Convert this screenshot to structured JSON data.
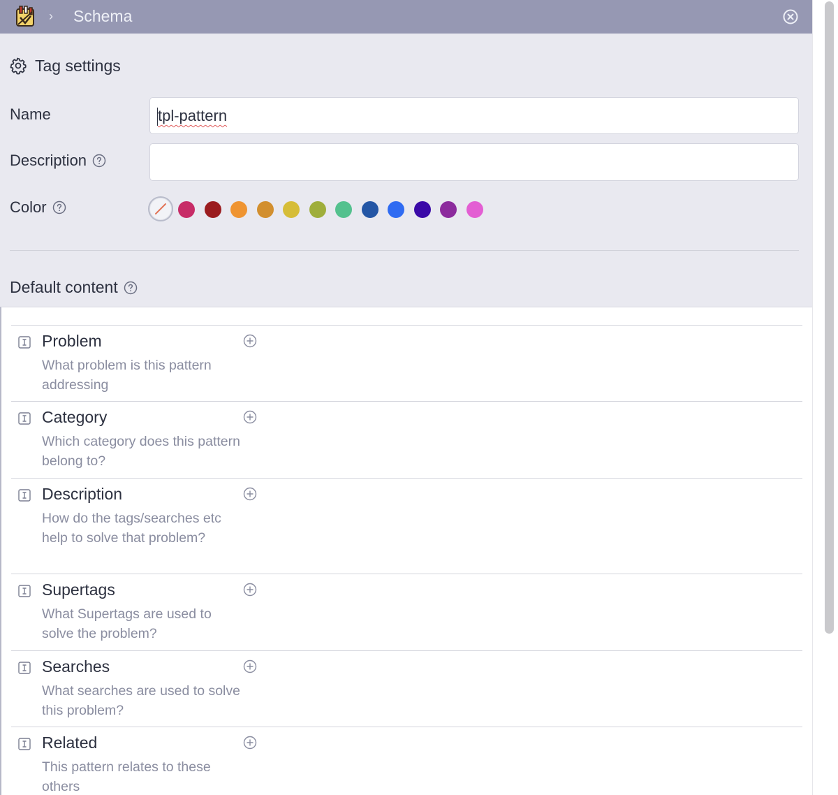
{
  "titlebar": {
    "breadcrumb_separator": "›",
    "title": "Schema"
  },
  "panel": {
    "heading": "Tag settings",
    "name_label": "Name",
    "name_value": "tpl-pattern",
    "description_label": "Description",
    "description_value": "",
    "color_label": "Color",
    "colors": [
      "#c72c67",
      "#9b1c1f",
      "#ef9431",
      "#d28f2f",
      "#d6bd38",
      "#9fae3b",
      "#54c18e",
      "#2456a5",
      "#2f6bf2",
      "#3b0aa8",
      "#8c2b9d",
      "#e35ed3"
    ],
    "selected_color": "none",
    "default_content_label": "Default content"
  },
  "fields": [
    {
      "title": "Problem",
      "description": "What problem is this pattern addressing"
    },
    {
      "title": "Category",
      "description": "Which category does this pattern belong to?"
    },
    {
      "title": "Description",
      "description": "How do the tags/searches etc help to solve that problem?"
    },
    {
      "title": "Supertags",
      "description": "What Supertags are used to solve the problem?"
    },
    {
      "title": "Searches",
      "description": "What searches are used to solve this problem?"
    },
    {
      "title": "Related",
      "description": "This pattern relates to these others"
    }
  ],
  "icons": {
    "logo": "app-logo-icon",
    "close": "close-circle-icon",
    "settings": "gear-icon",
    "help": "question-circle-icon",
    "field_type": "text-field-icon",
    "add": "plus-circle-icon",
    "no_color": "no-color-icon"
  }
}
